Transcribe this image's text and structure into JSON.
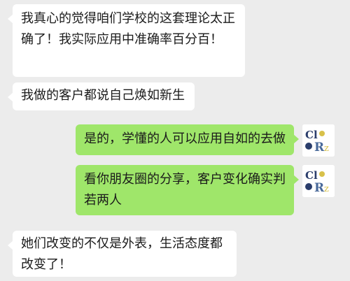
{
  "messages": [
    {
      "direction": "incoming",
      "text": "我真心的觉得咱们学校的这套理论太正确了！我实际应用中准确率百分百！"
    },
    {
      "direction": "incoming",
      "text": "我做的客户都说自己焕如新生"
    },
    {
      "direction": "outgoing",
      "text": "是的，学懂的人可以应用自如的去做"
    },
    {
      "direction": "outgoing",
      "text": "看你朋友圈的分享，客户变化确实判若两人"
    },
    {
      "direction": "incoming",
      "text": "她们改变的不仅是外表，生活态度都改变了！"
    }
  ],
  "avatar": {
    "icon": "colorz-logo-icon",
    "colors": [
      "#2a3d6b",
      "#d8c14a",
      "#4a6a9a"
    ]
  },
  "colors": {
    "background": "#ececec",
    "incoming_bubble": "#ffffff",
    "outgoing_bubble": "#9fe66a"
  }
}
